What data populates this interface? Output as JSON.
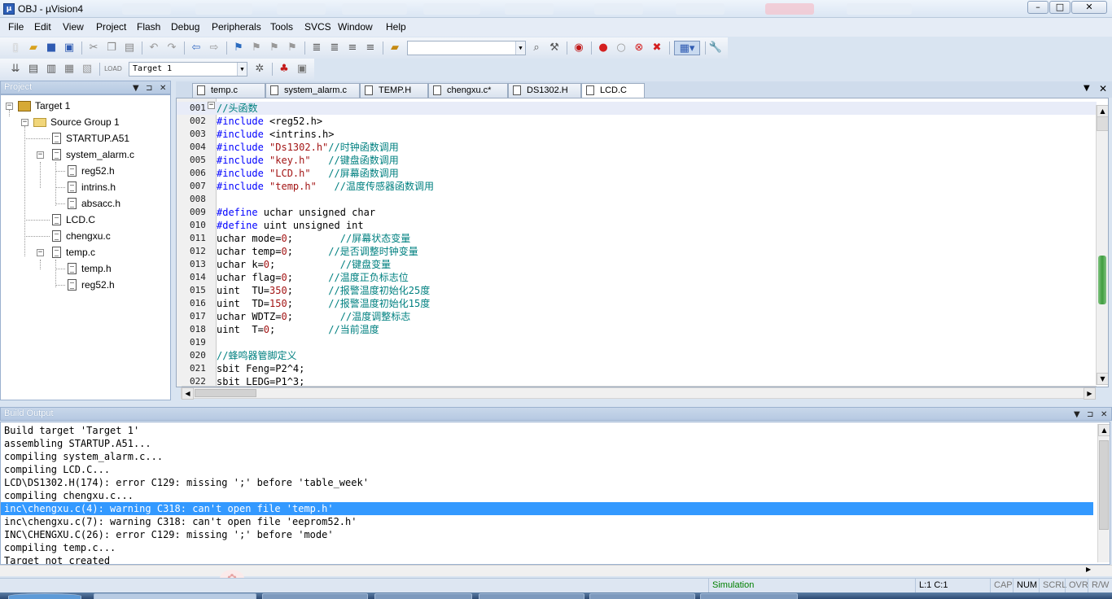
{
  "window": {
    "title": "OBJ  - µVision4",
    "controls": [
      "0",
      "□",
      "✕"
    ]
  },
  "menu": [
    "File",
    "Edit",
    "View",
    "Project",
    "Flash",
    "Debug",
    "Peripherals",
    "Tools",
    "SVCS",
    "Window",
    "Help"
  ],
  "toolbar": {
    "target_select": "Target 1",
    "find_combo_value": ""
  },
  "project_panel": {
    "title": "Project",
    "tree": {
      "target": "Target 1",
      "group": "Source Group 1",
      "files": [
        {
          "name": "STARTUP.A51",
          "children": []
        },
        {
          "name": "system_alarm.c",
          "children": [
            "reg52.h",
            "intrins.h",
            "absacc.h"
          ]
        },
        {
          "name": "LCD.C",
          "children": []
        },
        {
          "name": "chengxu.c",
          "children": []
        },
        {
          "name": "temp.c",
          "children": [
            "temp.h",
            "reg52.h"
          ]
        }
      ]
    }
  },
  "editor": {
    "tabs": [
      "temp.c",
      "system_alarm.c",
      "TEMP.H",
      "chengxu.c*",
      "DS1302.H",
      "LCD.C"
    ],
    "active_tab": "LCD.C",
    "lines": [
      {
        "n": "001",
        "segs": [
          {
            "t": "//头函数",
            "c": "cmt"
          }
        ]
      },
      {
        "n": "002",
        "segs": [
          {
            "t": "#include ",
            "c": "kw"
          },
          {
            "t": "<reg52.h>",
            "c": ""
          }
        ]
      },
      {
        "n": "003",
        "segs": [
          {
            "t": "#include ",
            "c": "kw"
          },
          {
            "t": "<intrins.h>",
            "c": ""
          }
        ]
      },
      {
        "n": "004",
        "segs": [
          {
            "t": "#include ",
            "c": "kw"
          },
          {
            "t": "\"Ds1302.h\"",
            "c": "str"
          },
          {
            "t": "//时钟函数调用",
            "c": "cmt"
          }
        ]
      },
      {
        "n": "005",
        "segs": [
          {
            "t": "#include ",
            "c": "kw"
          },
          {
            "t": "\"key.h\"",
            "c": "str"
          },
          {
            "t": "   //键盘函数调用",
            "c": "cmt"
          }
        ]
      },
      {
        "n": "006",
        "segs": [
          {
            "t": "#include ",
            "c": "kw"
          },
          {
            "t": "\"LCD.h\"",
            "c": "str"
          },
          {
            "t": "   //屏幕函数调用",
            "c": "cmt"
          }
        ]
      },
      {
        "n": "007",
        "segs": [
          {
            "t": "#include ",
            "c": "kw"
          },
          {
            "t": "\"temp.h\"",
            "c": "str"
          },
          {
            "t": "   //温度传感器函数调用",
            "c": "cmt"
          }
        ]
      },
      {
        "n": "008",
        "segs": []
      },
      {
        "n": "009",
        "segs": [
          {
            "t": "#define ",
            "c": "kw"
          },
          {
            "t": "uchar unsigned char",
            "c": ""
          }
        ]
      },
      {
        "n": "010",
        "segs": [
          {
            "t": "#define ",
            "c": "kw"
          },
          {
            "t": "uint unsigned int",
            "c": ""
          }
        ]
      },
      {
        "n": "011",
        "segs": [
          {
            "t": "uchar mode=",
            "c": ""
          },
          {
            "t": "0",
            "c": "num"
          },
          {
            "t": ";",
            "c": ""
          },
          {
            "t": "        //屏幕状态变量",
            "c": "cmt"
          }
        ]
      },
      {
        "n": "012",
        "segs": [
          {
            "t": "uchar temp=",
            "c": ""
          },
          {
            "t": "0",
            "c": "num"
          },
          {
            "t": ";",
            "c": ""
          },
          {
            "t": "      //是否调整时钟变量",
            "c": "cmt"
          }
        ]
      },
      {
        "n": "013",
        "segs": [
          {
            "t": "uchar k=",
            "c": ""
          },
          {
            "t": "0",
            "c": "num"
          },
          {
            "t": ";",
            "c": ""
          },
          {
            "t": "           //键盘变量",
            "c": "cmt"
          }
        ]
      },
      {
        "n": "014",
        "segs": [
          {
            "t": "uchar flag=",
            "c": ""
          },
          {
            "t": "0",
            "c": "num"
          },
          {
            "t": ";",
            "c": ""
          },
          {
            "t": "      //温度正负标志位",
            "c": "cmt"
          }
        ]
      },
      {
        "n": "015",
        "segs": [
          {
            "t": "uint  TU=",
            "c": ""
          },
          {
            "t": "350",
            "c": "num"
          },
          {
            "t": ";",
            "c": ""
          },
          {
            "t": "      //报警温度初始化25度",
            "c": "cmt"
          }
        ]
      },
      {
        "n": "016",
        "segs": [
          {
            "t": "uint  TD=",
            "c": ""
          },
          {
            "t": "150",
            "c": "num"
          },
          {
            "t": ";",
            "c": ""
          },
          {
            "t": "      //报警温度初始化15度",
            "c": "cmt"
          }
        ]
      },
      {
        "n": "017",
        "segs": [
          {
            "t": "uchar WDTZ=",
            "c": ""
          },
          {
            "t": "0",
            "c": "num"
          },
          {
            "t": ";",
            "c": ""
          },
          {
            "t": "        //温度调整标志",
            "c": "cmt"
          }
        ]
      },
      {
        "n": "018",
        "segs": [
          {
            "t": "uint  T=",
            "c": ""
          },
          {
            "t": "0",
            "c": "num"
          },
          {
            "t": ";",
            "c": ""
          },
          {
            "t": "         //当前温度",
            "c": "cmt"
          }
        ]
      },
      {
        "n": "019",
        "segs": []
      },
      {
        "n": "020",
        "segs": [
          {
            "t": "//蜂鸣器管脚定义",
            "c": "cmt"
          }
        ]
      },
      {
        "n": "021",
        "segs": [
          {
            "t": "sbit Feng=P2^4;",
            "c": ""
          }
        ]
      },
      {
        "n": "022",
        "segs": [
          {
            "t": "sbit LEDG=P1^3;",
            "c": ""
          }
        ]
      }
    ]
  },
  "build_output": {
    "title": "Build Output",
    "lines": [
      "Build target 'Target 1'",
      "assembling STARTUP.A51...",
      "compiling system_alarm.c...",
      "compiling LCD.C...",
      "LCD\\DS1302.H(174): error C129: missing ';' before 'table_week'",
      "compiling chengxu.c...",
      "inc\\chengxu.c(4): warning C318: can't open file 'temp.h'",
      "inc\\chengxu.c(7): warning C318: can't open file 'eeprom52.h'",
      "INC\\CHENGXU.C(26): error C129: missing ';' before 'mode'",
      "compiling temp.c...",
      "Target not created"
    ],
    "selected_index": 6
  },
  "status": {
    "mode": "Simulation",
    "position": "L:1 C:1",
    "caps": "CAP",
    "num": "NUM",
    "scrl": "SCRL",
    "ovr": "OVR",
    "rw": "R/W"
  },
  "colors": {
    "keyword": "#0000ff",
    "string": "#a31515",
    "comment": "#008080",
    "selection": "#3399ff",
    "simulation": "#008000"
  }
}
